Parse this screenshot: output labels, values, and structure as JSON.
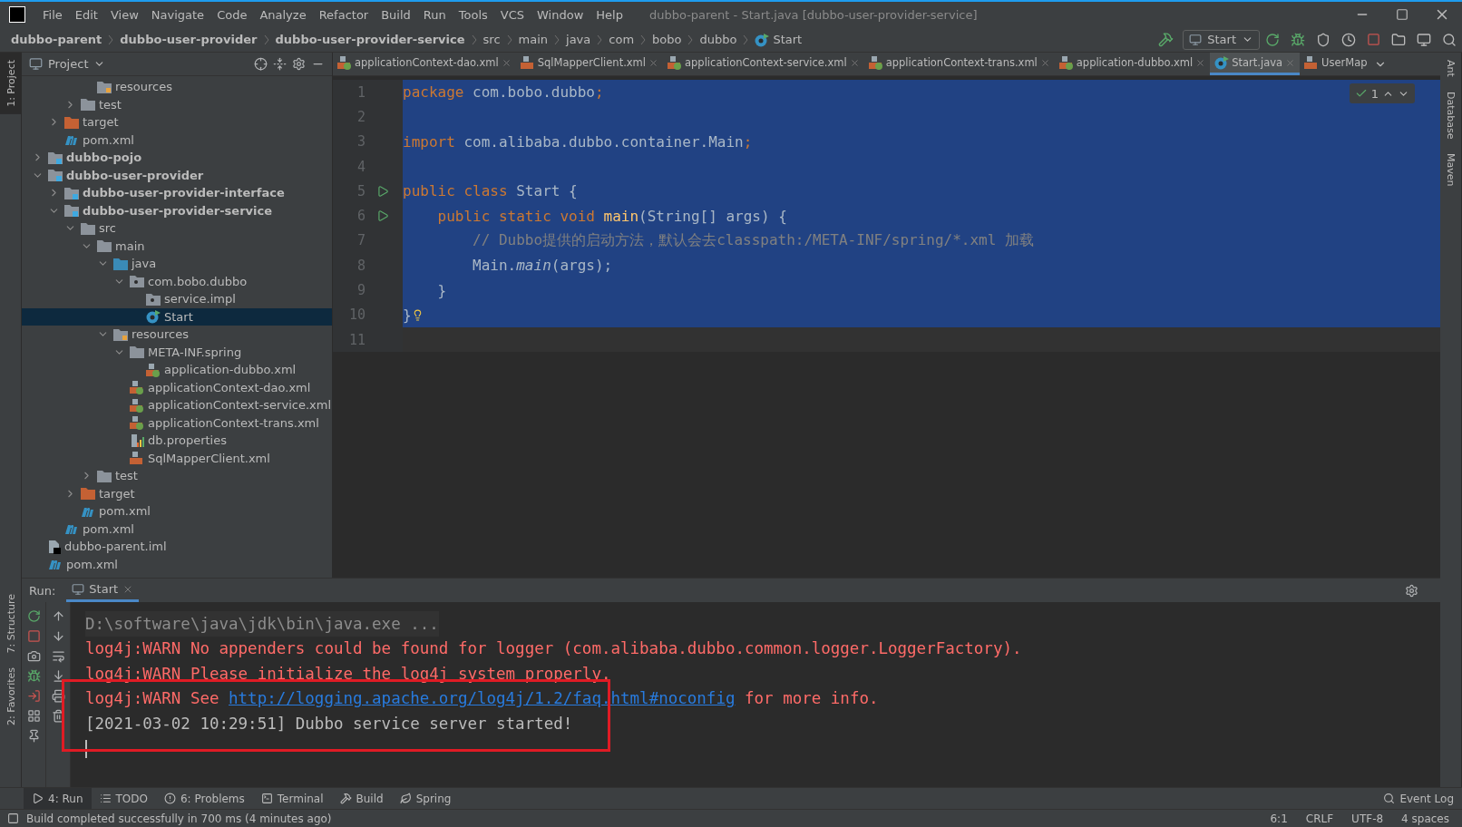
{
  "window": {
    "title": "dubbo-parent - Start.java [dubbo-user-provider-service]"
  },
  "menu": [
    "File",
    "Edit",
    "View",
    "Navigate",
    "Code",
    "Analyze",
    "Refactor",
    "Build",
    "Run",
    "Tools",
    "VCS",
    "Window",
    "Help"
  ],
  "breadcrumbs": [
    {
      "label": "dubbo-parent",
      "kind": "module"
    },
    {
      "label": "dubbo-user-provider",
      "kind": "module"
    },
    {
      "label": "dubbo-user-provider-service",
      "kind": "module"
    },
    {
      "label": "src",
      "kind": "folder"
    },
    {
      "label": "main",
      "kind": "folder"
    },
    {
      "label": "java",
      "kind": "folder"
    },
    {
      "label": "com",
      "kind": "folder"
    },
    {
      "label": "bobo",
      "kind": "folder"
    },
    {
      "label": "dubbo",
      "kind": "folder"
    },
    {
      "label": "Start",
      "kind": "class"
    }
  ],
  "run_config": "Start",
  "side_left": [
    "1: Project",
    "7: Structure",
    "2: Favorites"
  ],
  "side_right": [
    "Ant",
    "Database",
    "Maven"
  ],
  "project_panel": {
    "title": "Project"
  },
  "tree": [
    {
      "children": [
        {
          "children": [
            {
              "children": [
                {
                  "label": "resources",
                  "kind": "resources",
                  "selected": false
                }
              ]
            },
            {
              "label": "test",
              "kind": "folder",
              "expanded": false,
              "selected": false
            }
          ]
        },
        {
          "label": "target",
          "kind": "excluded",
          "expanded": false,
          "selected": false
        },
        {
          "label": "pom.xml",
          "kind": "maven",
          "selected": false
        }
      ]
    },
    {
      "label": "dubbo-pojo",
      "kind": "module",
      "expanded": false,
      "selected": false
    },
    {
      "label": "dubbo-user-provider",
      "kind": "module",
      "expanded": true,
      "selected": false,
      "children": [
        {
          "label": "dubbo-user-provider-interface",
          "kind": "module",
          "expanded": false,
          "selected": false
        },
        {
          "label": "dubbo-user-provider-service",
          "kind": "module",
          "expanded": true,
          "selected": false,
          "children": [
            {
              "label": "src",
              "kind": "folder",
              "expanded": true,
              "selected": false,
              "children": [
                {
                  "label": "main",
                  "kind": "folder",
                  "expanded": true,
                  "selected": false,
                  "children": [
                    {
                      "label": "java",
                      "kind": "source",
                      "expanded": true,
                      "selected": false,
                      "children": [
                        {
                          "label": "com.bobo.dubbo",
                          "kind": "package",
                          "expanded": true,
                          "selected": false,
                          "children": [
                            {
                              "label": "service.impl",
                              "kind": "package",
                              "selected": false
                            },
                            {
                              "label": "Start",
                              "kind": "java",
                              "selected": true
                            }
                          ]
                        }
                      ]
                    },
                    {
                      "label": "resources",
                      "kind": "resources",
                      "expanded": true,
                      "selected": false,
                      "children": [
                        {
                          "label": "META-INF.spring",
                          "kind": "folder",
                          "expanded": true,
                          "selected": false,
                          "children": [
                            {
                              "label": "application-dubbo.xml",
                              "kind": "spring-xml",
                              "selected": false
                            }
                          ]
                        },
                        {
                          "label": "applicationContext-dao.xml",
                          "kind": "spring-xml",
                          "selected": false
                        },
                        {
                          "label": "applicationContext-service.xml",
                          "kind": "spring-xml",
                          "selected": false
                        },
                        {
                          "label": "applicationContext-trans.xml",
                          "kind": "spring-xml",
                          "selected": false
                        },
                        {
                          "label": "db.properties",
                          "kind": "properties",
                          "selected": false
                        },
                        {
                          "label": "SqlMapperClient.xml",
                          "kind": "xml",
                          "selected": false
                        }
                      ]
                    }
                  ]
                },
                {
                  "label": "test",
                  "kind": "folder",
                  "expanded": false,
                  "selected": false
                }
              ]
            },
            {
              "label": "target",
              "kind": "excluded",
              "expanded": false,
              "selected": false
            },
            {
              "label": "pom.xml",
              "kind": "maven",
              "selected": false
            }
          ]
        },
        {
          "label": "pom.xml",
          "kind": "maven",
          "selected": false
        }
      ]
    },
    {
      "label": "dubbo-parent.iml",
      "kind": "iml",
      "selected": false
    },
    {
      "label": "pom.xml",
      "kind": "maven",
      "selected": false
    }
  ],
  "tabs": [
    {
      "label": "applicationContext-dao.xml",
      "kind": "spring-xml",
      "selected": false,
      "closable": true
    },
    {
      "label": "SqlMapperClient.xml",
      "kind": "xml",
      "selected": false,
      "closable": true
    },
    {
      "label": "applicationContext-service.xml",
      "kind": "spring-xml",
      "selected": false,
      "closable": true
    },
    {
      "label": "applicationContext-trans.xml",
      "kind": "spring-xml",
      "selected": false,
      "closable": true
    },
    {
      "label": "application-dubbo.xml",
      "kind": "spring-xml",
      "selected": false,
      "closable": true
    },
    {
      "label": "Start.java",
      "kind": "java",
      "selected": true,
      "closable": true
    },
    {
      "label": "UserMap",
      "kind": "xml",
      "selected": false,
      "closable": false
    }
  ],
  "inspection": {
    "count": "1"
  },
  "editor": {
    "lines": [
      {
        "number": "1",
        "selected": true,
        "runnable": false,
        "bulb": false,
        "tokens": [
          {
            "text": "package",
            "kind": "keyword"
          },
          {
            "text": " com.bobo.dubbo",
            "kind": "plain"
          },
          {
            "text": ";",
            "kind": "keyword"
          }
        ]
      },
      {
        "number": "2",
        "selected": true,
        "runnable": false,
        "bulb": false
      },
      {
        "number": "3",
        "selected": true,
        "runnable": false,
        "bulb": false,
        "tokens": [
          {
            "text": "import",
            "kind": "keyword"
          },
          {
            "text": " com.alibaba.dubbo.container.Main",
            "kind": "plain"
          },
          {
            "text": ";",
            "kind": "keyword"
          }
        ]
      },
      {
        "number": "4",
        "selected": true,
        "runnable": false,
        "bulb": false
      },
      {
        "number": "5",
        "selected": true,
        "runnable": true,
        "bulb": false,
        "tokens": [
          {
            "text": "public class",
            "kind": "keyword"
          },
          {
            "text": " Start {",
            "kind": "plain"
          }
        ]
      },
      {
        "number": "6",
        "selected": true,
        "runnable": true,
        "bulb": false,
        "tokens": [
          {
            "text": "    public static void ",
            "kind": "keyword"
          },
          {
            "text": "main",
            "kind": "method"
          },
          {
            "text": "(String[] args) {",
            "kind": "plain"
          }
        ]
      },
      {
        "number": "7",
        "selected": true,
        "runnable": false,
        "bulb": false,
        "tokens": [
          {
            "text": "        // Dubbo提供的启动方法，默认会去classpath:/META-INF/spring/*.xml 加载",
            "kind": "comment"
          }
        ]
      },
      {
        "number": "8",
        "selected": true,
        "runnable": false,
        "bulb": false,
        "tokens": [
          {
            "text": "        Main.",
            "kind": "plain"
          },
          {
            "text": "main",
            "kind": "static"
          },
          {
            "text": "(args);",
            "kind": "plain"
          }
        ]
      },
      {
        "number": "9",
        "selected": true,
        "runnable": false,
        "bulb": false,
        "tokens": [
          {
            "text": "    }",
            "kind": "plain"
          }
        ]
      },
      {
        "number": "10",
        "selected": true,
        "runnable": false,
        "bulb": true,
        "tokens": [
          {
            "text": "}",
            "kind": "plain"
          }
        ]
      },
      {
        "number": "11",
        "selected": false,
        "runnable": false,
        "bulb": false
      }
    ]
  },
  "run_panel": {
    "label": "Run:",
    "tab": "Start"
  },
  "console": [
    [
      {
        "text": "D:\\software\\java\\jdk\\bin\\java.exe ...",
        "kind": "command"
      }
    ],
    [
      {
        "text": "log4j:WARN No appenders could be found for logger (com.alibaba.dubbo.common.logger.LoggerFactory).",
        "kind": "warn"
      }
    ],
    [
      {
        "text": "log4j:WARN Please initialize the log4j system properly.",
        "kind": "warn"
      }
    ],
    [
      {
        "text": "log4j:WARN See ",
        "kind": "warn"
      },
      {
        "text": "http://logging.apache.org/log4j/1.2/faq.html#noconfig",
        "kind": "link"
      },
      {
        "text": " for more info.",
        "kind": "warn"
      }
    ],
    [
      {
        "text": "[2021-03-02 10:29:51] Dubbo service server started!",
        "kind": "plain"
      }
    ]
  ],
  "tool_windows": [
    {
      "label": "4: Run",
      "kind": "run",
      "selected": true
    },
    {
      "label": "TODO",
      "kind": "todo",
      "selected": false
    },
    {
      "label": "6: Problems",
      "kind": "problems",
      "selected": false
    },
    {
      "label": "Terminal",
      "kind": "terminal",
      "selected": false
    },
    {
      "label": "Build",
      "kind": "build",
      "selected": false
    },
    {
      "label": "Spring",
      "kind": "spring",
      "selected": false
    }
  ],
  "event_log": "Event Log",
  "status_bar": {
    "message": "Build completed successfully in 700 ms (4 minutes ago)",
    "items": [
      "6:1",
      "CRLF",
      "UTF-8",
      "4 spaces"
    ]
  }
}
